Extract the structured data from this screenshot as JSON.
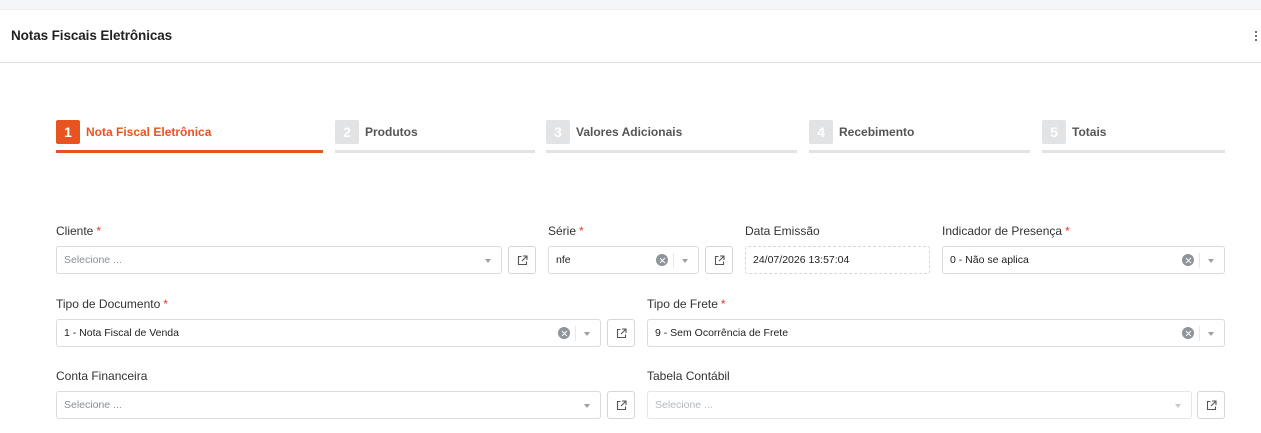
{
  "header": {
    "title": "Notas Fiscais Eletrônicas",
    "menu_icon": "kebab-menu-icon"
  },
  "colors": {
    "accent": "#e8541f",
    "required": "#e53935",
    "inactive_step": "#e2e3e5"
  },
  "steps": [
    {
      "number": "1",
      "label": "Nota Fiscal Eletrônica",
      "active": true
    },
    {
      "number": "2",
      "label": "Produtos",
      "active": false
    },
    {
      "number": "3",
      "label": "Valores Adicionais",
      "active": false
    },
    {
      "number": "4",
      "label": "Recebimento",
      "active": false
    },
    {
      "number": "5",
      "label": "Totais",
      "active": false
    }
  ],
  "required_mark": "*",
  "form": {
    "cliente": {
      "label": "Cliente",
      "required": true,
      "value": "",
      "placeholder": "Selecione ..."
    },
    "serie": {
      "label": "Série",
      "required": true,
      "value": "nfe"
    },
    "data_emissao": {
      "label": "Data Emissão",
      "value": "24/07/2026 13:57:04"
    },
    "indicador_presenca": {
      "label": "Indicador de Presença",
      "required": true,
      "value": "0 - Não se aplica"
    },
    "tipo_documento": {
      "label": "Tipo de Documento",
      "required": true,
      "value": "1 - Nota Fiscal de Venda"
    },
    "tipo_frete": {
      "label": "Tipo de Frete",
      "required": true,
      "value": "9 - Sem Ocorrência de Frete"
    },
    "conta_financeira": {
      "label": "Conta Financeira",
      "value": "",
      "placeholder": "Selecione ..."
    },
    "tabela_contabil": {
      "label": "Tabela Contábil",
      "value": "",
      "placeholder": "Selecione ...",
      "disabled": true
    }
  }
}
